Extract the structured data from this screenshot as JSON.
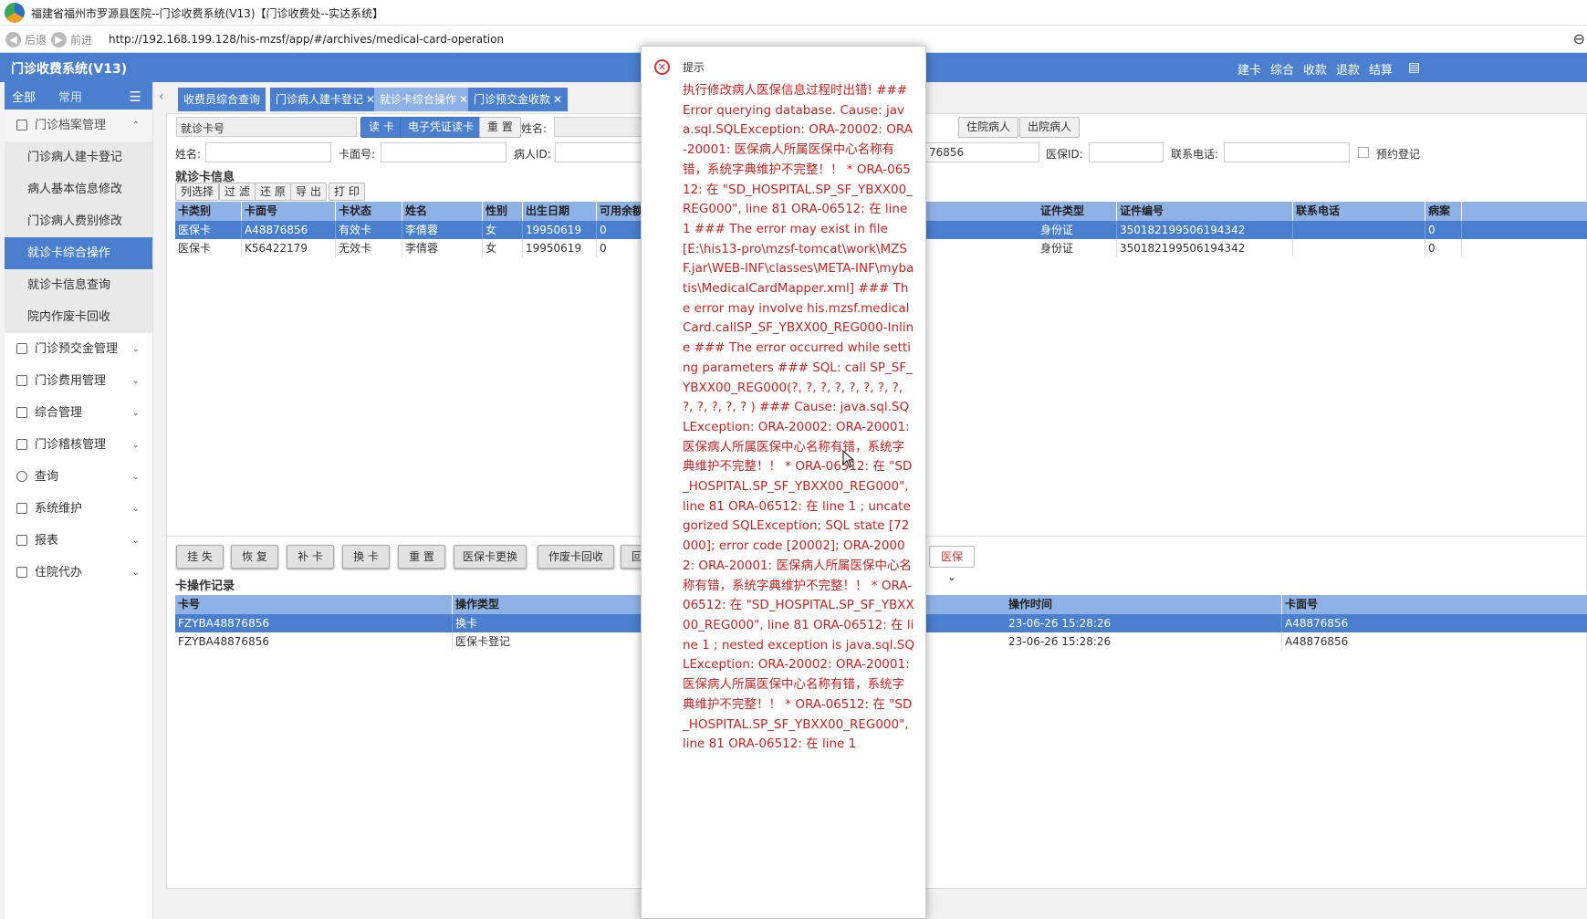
{
  "window": {
    "title": "福建省福州市罗源县医院--门诊收费系统(V13)【门诊收费处--实达系统】",
    "back_label": "后退",
    "forward_label": "前进",
    "url": "http://192.168.199.128/his-mzsf/app/#/archives/medical-card-operation"
  },
  "header": {
    "system_name": "门诊收费系统(V13)",
    "menus": [
      "建卡",
      "综合",
      "收款",
      "退款",
      "结算"
    ]
  },
  "sidebar": {
    "tabs": [
      "全部",
      "常用"
    ],
    "groups": [
      {
        "label": "门诊档案管理",
        "open": true,
        "items": [
          "门诊病人建卡登记",
          "病人基本信息修改",
          "门诊病人费别修改",
          "就诊卡综合操作",
          "就诊卡信息查询",
          "院内作废卡回收"
        ]
      },
      {
        "label": "门诊预交金管理"
      },
      {
        "label": "门诊费用管理"
      },
      {
        "label": "综合管理"
      },
      {
        "label": "门诊稽核管理"
      },
      {
        "label": "查询"
      },
      {
        "label": "系统维护"
      },
      {
        "label": "报表"
      },
      {
        "label": "住院代办"
      }
    ],
    "active_item": "就诊卡综合操作"
  },
  "tabs": [
    {
      "label": "收费员综合查询",
      "closable": false
    },
    {
      "label": "门诊病人建卡登记",
      "closable": true
    },
    {
      "label": "就诊卡综合操作",
      "closable": true
    },
    {
      "label": "门诊预交金收款",
      "closable": true
    }
  ],
  "toolbar": {
    "card_type_select": "就诊卡号",
    "read_card": "读 卡",
    "e_voucher": "电子凭证读卡",
    "reset": "重 置",
    "name_label": "姓名:",
    "inpatient": "住院病人",
    "discharged": "出院病人"
  },
  "filters": {
    "name_label": "姓名:",
    "card_label": "卡面号:",
    "patient_id_label": "病人ID:",
    "partial_value": "76856",
    "insurance_id_label": "医保ID:",
    "phone_label": "联系电话:",
    "appointment_label": "预约登记"
  },
  "card_section": {
    "title": "就诊卡信息",
    "actions": [
      "列选择",
      "过 滤",
      "还 原",
      "导 出",
      "打 印"
    ],
    "columns_left": [
      "卡类别",
      "卡面号",
      "卡状态",
      "姓名",
      "性别",
      "出生日期",
      "可用余额"
    ],
    "columns_right": [
      "证件类型",
      "证件编号",
      "联系电话",
      "病案"
    ],
    "rows": [
      {
        "type": "医保卡",
        "card_no": "A48876856",
        "status": "有效卡",
        "name": "李倩蓉",
        "sex": "女",
        "birth": "19950619",
        "balance": "0",
        "id_type": "身份证",
        "id_no": "350182199506194342",
        "phone": "",
        "record": "0"
      },
      {
        "type": "医保卡",
        "card_no": "K56422179",
        "status": "无效卡",
        "name": "李倩蓉",
        "sex": "女",
        "birth": "19950619",
        "balance": "0",
        "id_type": "身份证",
        "id_no": "350182199506194342",
        "phone": "",
        "record": "0"
      }
    ]
  },
  "card_actions": [
    "挂 失",
    "恢 复",
    "补 卡",
    "换 卡",
    "重 置",
    "医保卡更换",
    "作废卡回收",
    "回收"
  ],
  "card_actions_right": "医保",
  "ops_section": {
    "title": "卡操作记录",
    "columns_left": [
      "卡号",
      "操作类型"
    ],
    "columns_right": [
      "操作时间",
      "卡面号"
    ],
    "rows": [
      {
        "card": "FZYBA48876856",
        "op": "换卡",
        "time": "23-06-26 15:28:26",
        "face": "A48876856"
      },
      {
        "card": "FZYBA48876856",
        "op": "医保卡登记",
        "time": "23-06-26 15:28:26",
        "face": "A48876856"
      }
    ]
  },
  "dialog": {
    "title": "提示",
    "message": "执行修改病人医保信息过程时出错! ### Error querying database. Cause: java.sql.SQLException: ORA-20002: ORA-20001: 医保病人所属医保中心名称有错，系统字典维护不完整！！ * ORA-06512: 在 \"SD_HOSPITAL.SP_SF_YBXX00_REG000\", line 81 ORA-06512: 在 line 1 ### The error may exist in file [E:\\his13-pro\\mzsf-tomcat\\work\\MZSF.jar\\WEB-INF\\classes\\META-INF\\mybatis\\MedicalCardMapper.xml] ### The error may involve his.mzsf.medicalCard.callSP_SF_YBXX00_REG000-Inline ### The error occurred while setting parameters ### SQL: call SP_SF_YBXX00_REG000(?, ?, ?, ?, ?, ?, ?, ?, ?, ?, ?, ?, ?         ) ### Cause: java.sql.SQLException: ORA-20002: ORA-20001: 医保病人所属医保中心名称有错，系统字典维护不完整！！ * ORA-06512: 在 \"SD_HOSPITAL.SP_SF_YBXX00_REG000\", line 81 ORA-06512: 在 line 1 ; uncategorized SQLException; SQL state [72000]; error code [20002]; ORA-20002: ORA-20001: 医保病人所属医保中心名称有错，系统字典维护不完整！！ * ORA-06512: 在 \"SD_HOSPITAL.SP_SF_YBXX00_REG000\", line 81 ORA-06512: 在 line 1 ; nested exception is java.sql.SQLException: ORA-20002: ORA-20001: 医保病人所属医保中心名称有错，系统字典维护不完整！！ * ORA-06512: 在 \"SD_HOSPITAL.SP_SF_YBXX00_REG000\", line 81 ORA-06512: 在 line 1"
  },
  "colors": {
    "accent": "#4a7fd0",
    "header_row": "#8fb2e6",
    "error_text": "#d42020"
  }
}
